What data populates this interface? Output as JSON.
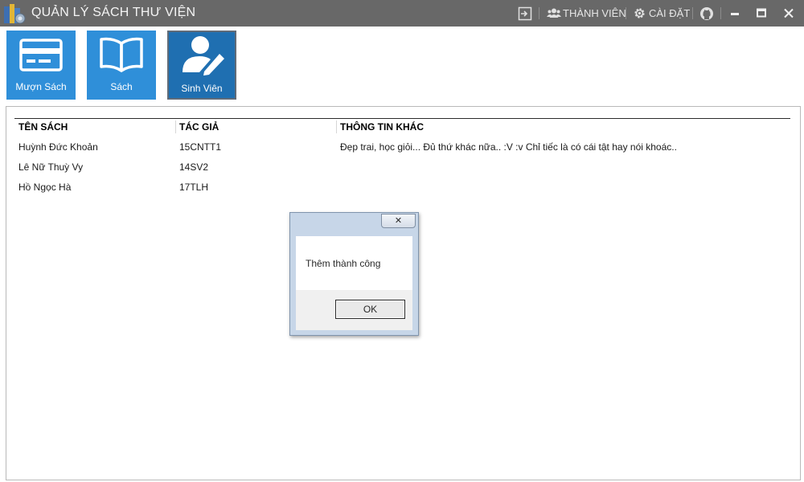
{
  "window": {
    "title": "QUẢN LÝ SÁCH THƯ VIỆN",
    "members_label": "THÀNH VIÊN",
    "settings_label": "CÀI ĐẶT"
  },
  "tiles": [
    {
      "label": "Mượn Sách",
      "icon": "card-icon",
      "active": false
    },
    {
      "label": "Sách",
      "icon": "book-icon",
      "active": false
    },
    {
      "label": "Sinh Viên",
      "icon": "user-edit-icon",
      "active": true
    }
  ],
  "table": {
    "columns": [
      "TÊN SÁCH",
      "TÁC GIẢ",
      "THÔNG TIN KHÁC"
    ],
    "rows": [
      [
        "Huỳnh Đức Khoản",
        "15CNTT1",
        "Đẹp trai, học giỏi... Đủ thứ khác nữa.. :V :v  Chỉ tiếc là có cái tật hay nói khoác.."
      ],
      [
        "Lê Nữ Thuỳ Vy",
        "14SV2",
        ""
      ],
      [
        "Hồ Ngọc Hà",
        "17TLH",
        ""
      ]
    ]
  },
  "dialog": {
    "close_glyph": "✕",
    "message": "Thêm thành công",
    "ok_label": "OK"
  },
  "colors": {
    "titlebar": "#686868",
    "tile": "#2f8fd9",
    "tile_active": "#1f6fb1"
  }
}
